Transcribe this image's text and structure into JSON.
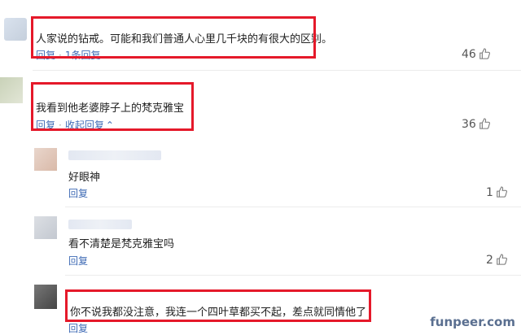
{
  "comments": [
    {
      "text": "人家说的钻戒。可能和我们普通人心里几千块的有很大的区别。",
      "reply": "回复",
      "expand": "1条回复",
      "expand_icon": "chevron-down",
      "likes": "46"
    },
    {
      "text": "我看到他老婆脖子上的梵克雅宝",
      "reply": "回复",
      "expand": "收起回复",
      "expand_icon": "chevron-up",
      "likes": "36"
    }
  ],
  "replies": [
    {
      "text": "好眼神",
      "reply": "回复",
      "likes": "1"
    },
    {
      "text": "看不清楚是梵克雅宝吗",
      "reply": "回复",
      "likes": "2"
    },
    {
      "text": "你不说我都没注意，我连一个四叶草都买不起，差点就同情他了",
      "reply": "回复",
      "likes": ""
    }
  ],
  "watermark": "funpeer.com",
  "colors": {
    "highlight": "#e5192a",
    "link": "#3f6bb5",
    "text": "#222222"
  }
}
